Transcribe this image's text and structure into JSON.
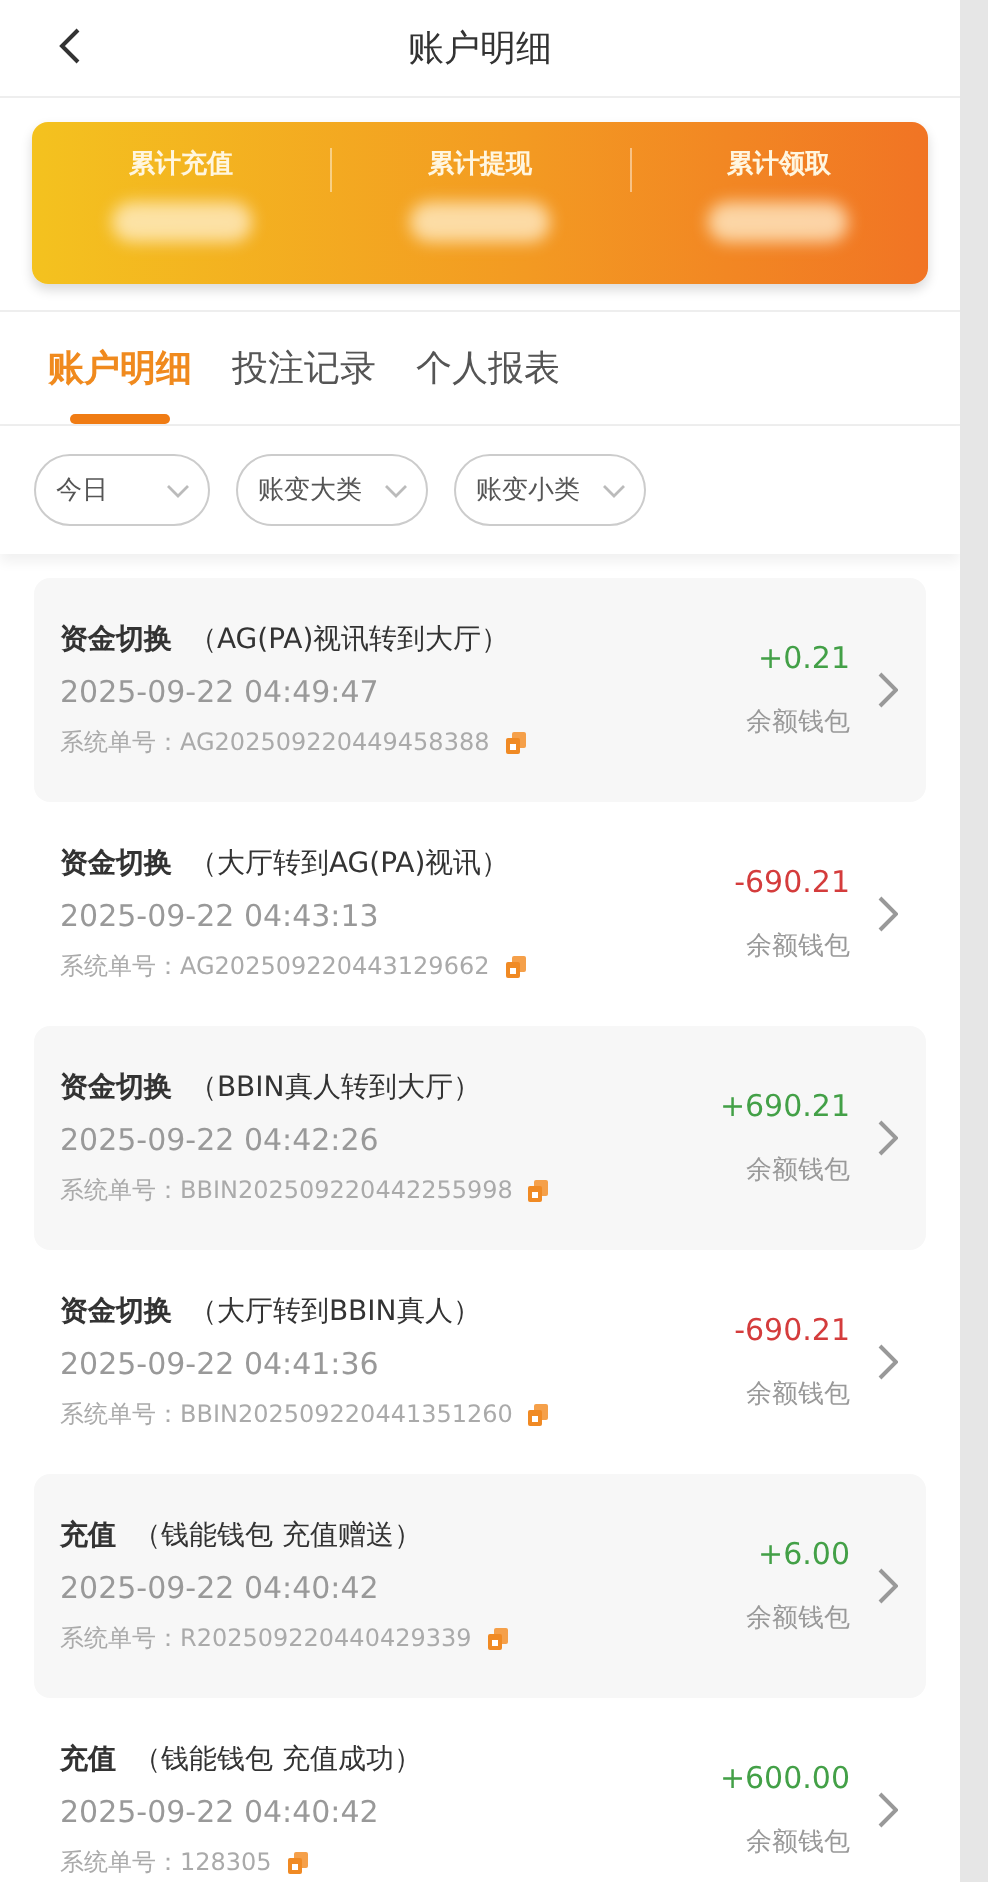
{
  "header": {
    "title": "账户明细"
  },
  "summary": [
    {
      "label": "累计充值"
    },
    {
      "label": "累计提现"
    },
    {
      "label": "累计领取"
    }
  ],
  "tabs": [
    {
      "label": "账户明细",
      "selected": true
    },
    {
      "label": "投注记录",
      "selected": false
    },
    {
      "label": "个人报表",
      "selected": false
    }
  ],
  "filters": [
    {
      "label": "今日"
    },
    {
      "label": "账变大类"
    },
    {
      "label": "账变小类"
    }
  ],
  "records": [
    {
      "type": "资金切换",
      "detail": "（AG(PA)视讯转到大厅）",
      "time": "2025-09-22 04:49:47",
      "order_label": "系统单号：",
      "order": "AG202509220449458388",
      "amount": "+0.21",
      "color": "#43a047",
      "wallet": "余额钱包"
    },
    {
      "type": "资金切换",
      "detail": "（大厅转到AG(PA)视讯）",
      "time": "2025-09-22 04:43:13",
      "order_label": "系统单号：",
      "order": "AG202509220443129662",
      "amount": "-690.21",
      "color": "#d43c3c",
      "wallet": "余额钱包"
    },
    {
      "type": "资金切换",
      "detail": "（BBIN真人转到大厅）",
      "time": "2025-09-22 04:42:26",
      "order_label": "系统单号：",
      "order": "BBIN202509220442255998",
      "amount": "+690.21",
      "color": "#43a047",
      "wallet": "余额钱包"
    },
    {
      "type": "资金切换",
      "detail": "（大厅转到BBIN真人）",
      "time": "2025-09-22 04:41:36",
      "order_label": "系统单号：",
      "order": "BBIN202509220441351260",
      "amount": "-690.21",
      "color": "#d43c3c",
      "wallet": "余额钱包"
    },
    {
      "type": "充值",
      "detail": "（钱能钱包 充值赠送）",
      "time": "2025-09-22 04:40:42",
      "order_label": "系统单号：",
      "order": "R202509220440429339",
      "amount": "+6.00",
      "color": "#43a047",
      "wallet": "余额钱包"
    },
    {
      "type": "充值",
      "detail": "（钱能钱包 充值成功）",
      "time": "2025-09-22 04:40:42",
      "order_label": "系统单号：",
      "order": "128305",
      "amount": "+600.00",
      "color": "#43a047",
      "wallet": "余额钱包"
    }
  ]
}
